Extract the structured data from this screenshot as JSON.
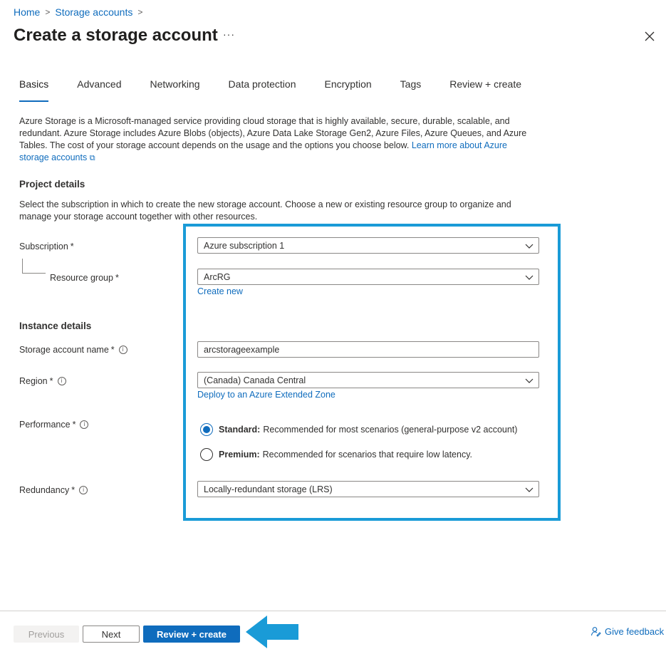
{
  "breadcrumb": {
    "items": [
      "Home",
      "Storage accounts"
    ],
    "separator": ">"
  },
  "page": {
    "title": "Create a storage account",
    "more": "···"
  },
  "tabs": [
    "Basics",
    "Advanced",
    "Networking",
    "Data protection",
    "Encryption",
    "Tags",
    "Review + create"
  ],
  "intro": {
    "text": "Azure Storage is a Microsoft-managed service providing cloud storage that is highly available, secure, durable, scalable, and redundant. Azure Storage includes Azure Blobs (objects), Azure Data Lake Storage Gen2, Azure Files, Azure Queues, and Azure Tables. The cost of your storage account depends on the usage and the options you choose below.",
    "link": "Learn more about Azure storage accounts"
  },
  "project": {
    "title": "Project details",
    "description": "Select the subscription in which to create the new storage account. Choose a new or existing resource group to organize and manage your storage account together with other resources.",
    "subscription_label": "Subscription",
    "subscription_value": "Azure subscription 1",
    "resource_group_label": "Resource group",
    "resource_group_value": "ArcRG",
    "create_new": "Create new"
  },
  "instance": {
    "title": "Instance details",
    "name_label": "Storage account name",
    "name_value": "arcstorageexample",
    "region_label": "Region",
    "region_value": "(Canada) Canada Central",
    "extended_zone_link": "Deploy to an Azure Extended Zone",
    "performance_label": "Performance",
    "standard_title": "Standard:",
    "standard_desc": "Recommended for most scenarios (general-purpose v2 account)",
    "premium_title": "Premium:",
    "premium_desc": "Recommended for scenarios that require low latency.",
    "redundancy_label": "Redundancy",
    "redundancy_value": "Locally-redundant storage (LRS)"
  },
  "required_marker": "*",
  "footer": {
    "previous": "Previous",
    "next": "Next",
    "review_create": "Review + create",
    "feedback": "Give feedback"
  },
  "colors": {
    "accent": "#0f6cbd",
    "highlight": "#1a9bd7",
    "arrow": "#1a9bd7"
  }
}
